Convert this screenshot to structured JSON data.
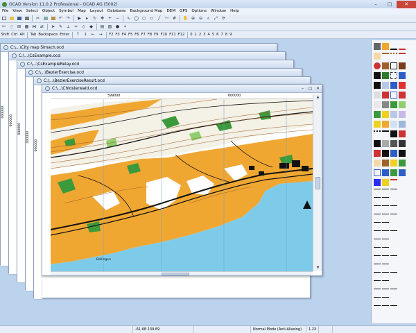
{
  "app": {
    "title": "OCAD Version 11.0.2  Professional - OCAD AG (5002)",
    "window_controls": {
      "minimize": "–",
      "maximize": "□",
      "close": "✕"
    }
  },
  "menu": [
    "File",
    "View",
    "Select",
    "Object",
    "Symbol",
    "Map",
    "Layout",
    "Database",
    "Background Map",
    "DEM",
    "GPS",
    "Options",
    "Window",
    "Help"
  ],
  "keyboard_toolbar": {
    "keys": [
      "Shift",
      "Ctrl",
      "Alt",
      "Tab",
      "Backspace",
      "Enter",
      "F2",
      "F3",
      "F4",
      "F5",
      "F6",
      "F7",
      "F8",
      "F9",
      "F10",
      "F11",
      "F12",
      "0",
      "1",
      "2",
      "3",
      "4",
      "5",
      "6",
      "7",
      "8",
      "9"
    ]
  },
  "documents": [
    {
      "title": "C:\\...\\City map Simach.ocd",
      "ruler_label": "000000"
    },
    {
      "title": "C:\\...\\CsExample.ocd",
      "ruler_label": "000000"
    },
    {
      "title": "C:\\...\\CsExampleRelay.ocd",
      "ruler_label": "000000"
    },
    {
      "title": "C:\\...\\BezierExercise.ocd",
      "ruler_label": "000000"
    },
    {
      "title": "C:\\...\\BezierExerciseResult.ocd",
      "ruler_label": "000000"
    }
  ],
  "active_document": {
    "title": "C:\\...\\Chlosterwald.ocd",
    "ruler_x": [
      "599000",
      "600000"
    ],
    "place_label": "Bollingen",
    "window_controls": {
      "minimize": "–",
      "maximize": "□",
      "close": "✕"
    }
  },
  "status": {
    "coords": "-61.68    139.69",
    "mode": "Normal Mode (Anti-Aliasing)",
    "zoom": "1.2X"
  },
  "colors": {
    "desktop": "#bcd3ee",
    "map_open_land": "#f0a732",
    "map_forest": "#ffffff",
    "map_green": "#3c9a3c",
    "map_water": "#7ecbe9",
    "map_black": "#111111"
  }
}
